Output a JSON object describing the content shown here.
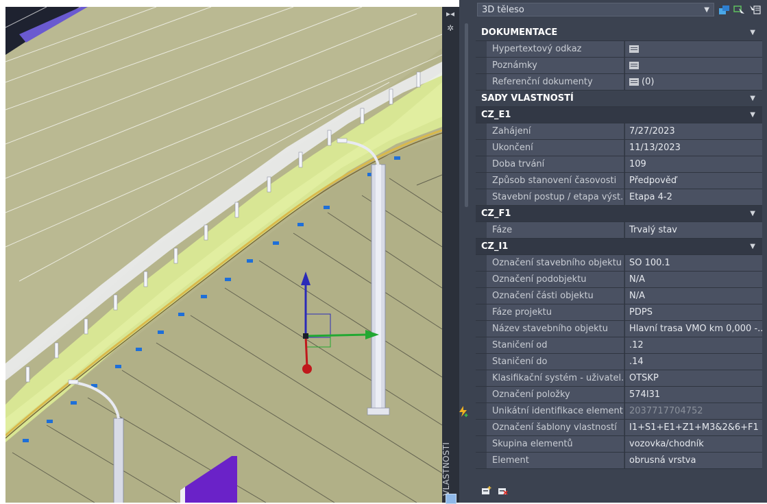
{
  "panel": {
    "object_type": "3D těleso",
    "side_label": "VLASTNOSTI",
    "sections": [
      {
        "title": "DOKUMENTACE",
        "kind": "section",
        "rows": [
          {
            "name": "Hypertextový odkaz",
            "value": "",
            "icon": "doc-icon"
          },
          {
            "name": "Poznámky",
            "value": "",
            "icon": "doc-icon"
          },
          {
            "name": "Referenční dokumenty",
            "value": "(0)",
            "icon": "doc-icon"
          }
        ]
      },
      {
        "title": "SADY VLASTNOSTÍ",
        "kind": "section",
        "rows": []
      },
      {
        "title": "CZ_E1",
        "kind": "sub",
        "rows": [
          {
            "name": "Zahájení",
            "value": "7/27/2023"
          },
          {
            "name": "Ukončení",
            "value": "11/13/2023"
          },
          {
            "name": "Doba trvání",
            "value": "109"
          },
          {
            "name": "Způsob stanovení časovosti",
            "value": "Předpověď"
          },
          {
            "name": "Stavební postup / etapa výst...",
            "value": "Etapa 4-2"
          }
        ]
      },
      {
        "title": "CZ_F1",
        "kind": "sub",
        "rows": [
          {
            "name": "Fáze",
            "value": "Trvalý stav"
          }
        ]
      },
      {
        "title": "CZ_I1",
        "kind": "sub",
        "rows": [
          {
            "name": "Označení stavebního objektu",
            "value": "SO 100.1"
          },
          {
            "name": "Označení podobjektu",
            "value": "N/A"
          },
          {
            "name": "Označení části objektu",
            "value": "N/A"
          },
          {
            "name": "Fáze projektu",
            "value": "PDPS"
          },
          {
            "name": "Název stavebního objektu",
            "value": "Hlavní trasa VMO km 0,000 -..."
          },
          {
            "name": "Staničení od",
            "value": ".12"
          },
          {
            "name": "Staničení do",
            "value": ".14"
          },
          {
            "name": "Klasifikační systém - uživatel...",
            "value": "OTSKP"
          },
          {
            "name": "Označení položky",
            "value": "574I31"
          },
          {
            "name": "Unikátní identifikace element...",
            "value": "2037717704752",
            "dim": true,
            "bolt": true
          },
          {
            "name": "Označení šablony vlastností",
            "value": "I1+S1+E1+Z1+M3&2&6+F1"
          },
          {
            "name": "Skupina elementů",
            "value": "vozovka/chodník"
          },
          {
            "name": "Element",
            "value": "obrusná vrstva"
          }
        ]
      }
    ]
  },
  "colors": {
    "panel_bg": "#3b4250",
    "row_bg": "#4a5162",
    "viewport_bg": "#b4b38a",
    "axis_x": "#22a832",
    "axis_y": "#2a2ab8",
    "axis_z": "#c0181c"
  },
  "icons": {
    "toolbar": [
      "toggle-pickadd-icon",
      "select-objects-icon",
      "quick-select-icon"
    ],
    "strip": [
      "pin-icon",
      "settings-icon",
      "properties-icon"
    ],
    "bottom": [
      "add-property-set-icon",
      "remove-property-set-icon"
    ]
  }
}
